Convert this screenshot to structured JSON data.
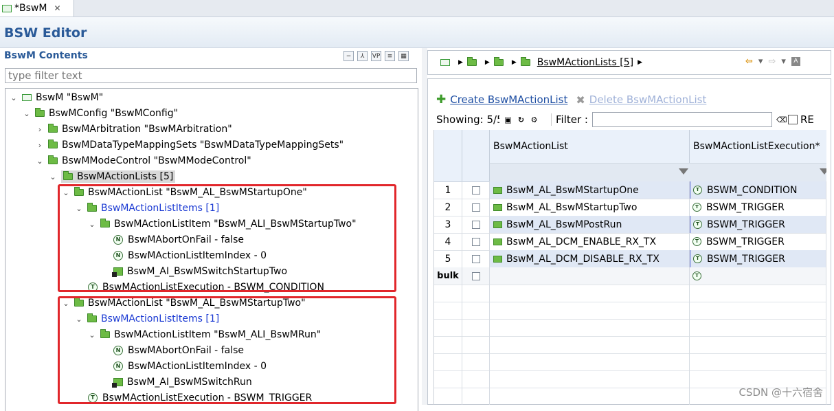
{
  "tab": {
    "label": "*BswM",
    "close": "✕"
  },
  "editor": {
    "title": "BSW Editor"
  },
  "left": {
    "section_title": "BswM Contents",
    "filter_placeholder": "type filter text",
    "tree": [
      {
        "label": "BswM \"BswM\""
      },
      {
        "label": "BswMConfig \"BswMConfig\""
      },
      {
        "label": "BswMArbitration \"BswMArbitration\""
      },
      {
        "label": "BswMDataTypeMappingSets \"BswMDataTypeMappingSets\""
      },
      {
        "label": "BswMModeControl \"BswMModeControl\""
      },
      {
        "label": "BswMActionLists [5]"
      },
      {
        "label": "BswMActionList \"BswM_AL_BswMStartupOne\""
      },
      {
        "label": "BswMActionListItems [1]"
      },
      {
        "label": "BswMActionListItem \"BswM_ALI_BswMStartupTwo\""
      },
      {
        "label": "BswMAbortOnFail - false"
      },
      {
        "label": "BswMActionListItemIndex - 0"
      },
      {
        "label": "BswM_AI_BswMSwitchStartupTwo"
      },
      {
        "label": "BswMActionListExecution - BSWM_CONDITION"
      },
      {
        "label": "BswMActionList \"BswM_AL_BswMStartupTwo\""
      },
      {
        "label": "BswMActionListItems [1]"
      },
      {
        "label": "BswMActionListItem \"BswM_ALI_BswMRun\""
      },
      {
        "label": "BswMAbortOnFail - false"
      },
      {
        "label": "BswMActionListItemIndex - 0"
      },
      {
        "label": "BswM_AI_BswMSwitchRun"
      },
      {
        "label": "BswMActionListExecution - BSWM_TRIGGER"
      }
    ]
  },
  "right": {
    "breadcrumb": "BswMActionLists [5]",
    "create_label": "Create BswMActionList",
    "delete_label": "Delete BswMActionList",
    "showing": "Showing: 5/5",
    "filter_label": "Filter :",
    "re_label": "RE",
    "columns": [
      "BswMActionList",
      "BswMActionListExecution*"
    ],
    "rows": [
      {
        "num": "1",
        "list": "BswM_AL_BswMStartupOne",
        "exec": "BSWM_CONDITION"
      },
      {
        "num": "2",
        "list": "BswM_AL_BswMStartupTwo",
        "exec": "BSWM_TRIGGER"
      },
      {
        "num": "3",
        "list": "BswM_AL_BswMPostRun",
        "exec": "BSWM_TRIGGER"
      },
      {
        "num": "4",
        "list": "BswM_AL_DCM_ENABLE_RX_TX",
        "exec": "BSWM_TRIGGER"
      },
      {
        "num": "5",
        "list": "BswM_AL_DCM_DISABLE_RX_TX",
        "exec": "BSWM_TRIGGER"
      }
    ],
    "bulk_label": "bulk"
  },
  "watermark": "CSDN @十六宿舍",
  "colors": {
    "accent": "#2a5a98",
    "highlight_box": "#e1262b",
    "link": "#1c3bd3"
  }
}
